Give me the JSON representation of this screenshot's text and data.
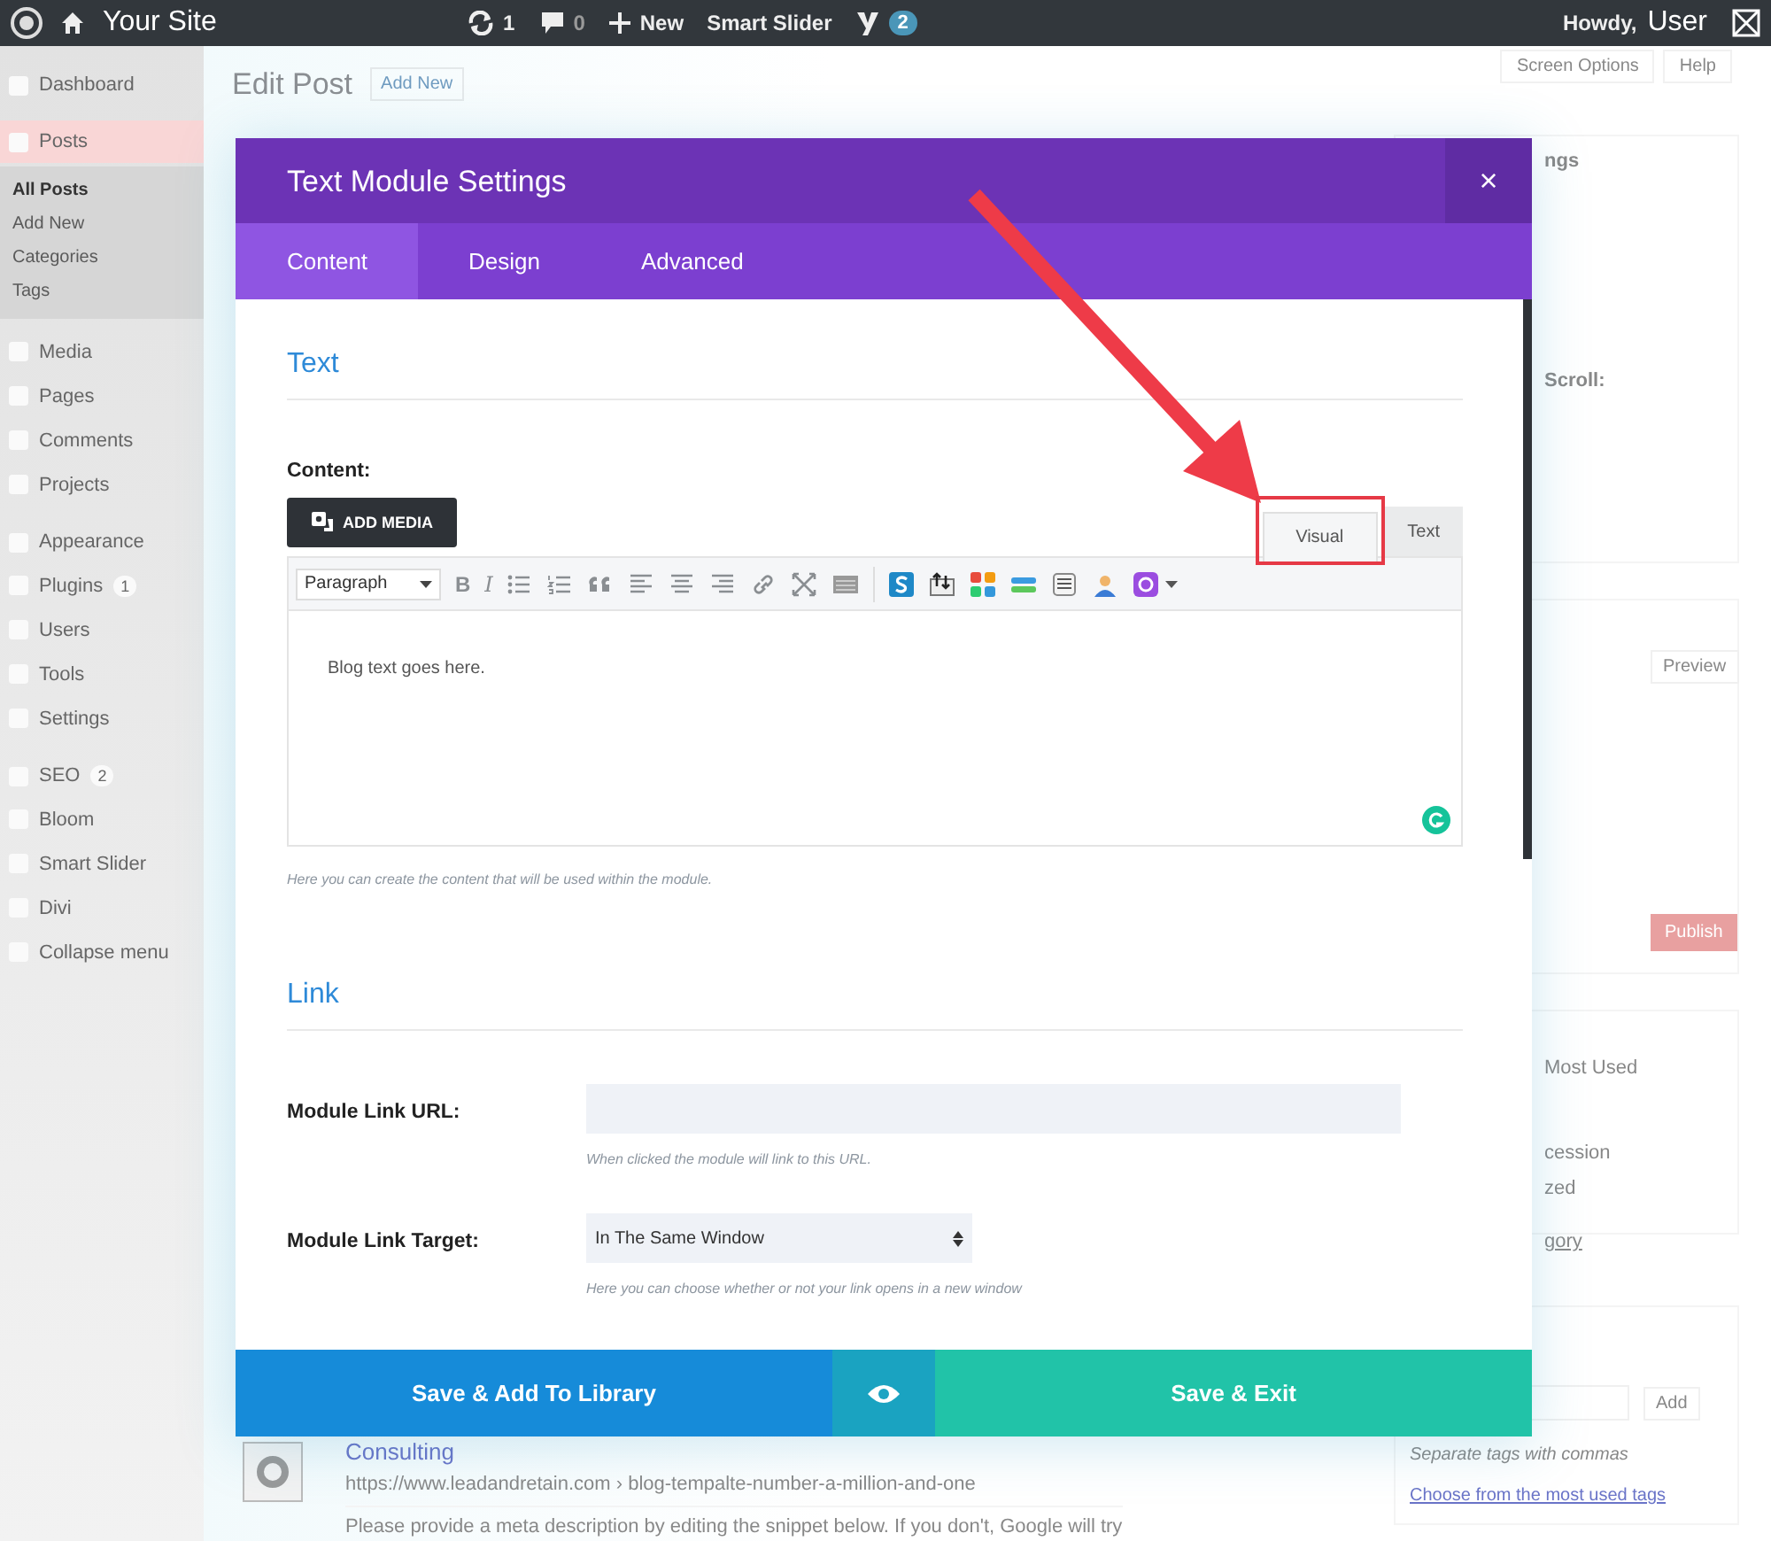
{
  "admin_bar": {
    "site_name": "Your Site",
    "updates": "1",
    "comments": "0",
    "new": "New",
    "smart_slider": "Smart Slider",
    "seo_badge": "2",
    "greeting": "Howdy,",
    "user": "User"
  },
  "sidebar": {
    "groups": [
      [
        {
          "label": "Dashboard",
          "selected": false
        }
      ],
      [
        {
          "label": "Posts",
          "selected": true,
          "children": [
            {
              "label": "All Posts",
              "selected": true
            },
            {
              "label": "Add New",
              "selected": false
            },
            {
              "label": "Categories",
              "selected": false
            },
            {
              "label": "Tags",
              "selected": false
            }
          ]
        },
        {
          "label": "Media",
          "selected": false
        },
        {
          "label": "Pages",
          "selected": false
        },
        {
          "label": "Comments",
          "selected": false
        },
        {
          "label": "Projects",
          "selected": false
        }
      ],
      [
        {
          "label": "Appearance",
          "selected": false
        },
        {
          "label": "Plugins",
          "selected": false,
          "badge": "1"
        },
        {
          "label": "Users",
          "selected": false
        },
        {
          "label": "Tools",
          "selected": false
        },
        {
          "label": "Settings",
          "selected": false
        }
      ],
      [
        {
          "label": "SEO",
          "selected": false,
          "badge": "2"
        },
        {
          "label": "Bloom",
          "selected": false
        },
        {
          "label": "Smart Slider",
          "selected": false
        },
        {
          "label": "Divi",
          "selected": false
        },
        {
          "label": "Collapse menu",
          "selected": false
        }
      ]
    ]
  },
  "page": {
    "title": "Edit Post",
    "add_new": "Add New",
    "screen_options": "Screen Options",
    "help": "Help"
  },
  "right_panel": {
    "settings_header": "ngs",
    "scroll_label": "Scroll:",
    "preview": "Preview",
    "publish": "Publish",
    "most_used": "Most Used",
    "category_items": [
      "cession",
      "zed"
    ],
    "category_link": "gory",
    "tag_add": "Add",
    "tag_hint": "Separate tags with commas",
    "tag_link": "Choose from the most used tags"
  },
  "seo_preview": {
    "title": "Consulting",
    "url": "https://www.leadandretain.com › blog-tempalte-number-a-million-and-one",
    "description": "Please provide a meta description by editing the snippet below. If you don't, Google will try"
  },
  "modal": {
    "title": "Text Module Settings",
    "close": "×",
    "tabs": [
      {
        "label": "Content",
        "selected": true
      },
      {
        "label": "Design",
        "selected": false
      },
      {
        "label": "Advanced",
        "selected": false
      }
    ],
    "text_section": {
      "heading": "Text",
      "field_label": "Content:",
      "add_media": "ADD MEDIA",
      "editor_tabs": [
        {
          "label": "Visual",
          "selected": true,
          "highlighted": true
        },
        {
          "label": "Text",
          "selected": false,
          "highlighted": false
        }
      ],
      "format": "Paragraph",
      "bold_glyph": "B",
      "italic_glyph": "I",
      "content": "Blog text goes here.",
      "help": "Here you can create the content that will be used within the module."
    },
    "link_section": {
      "heading": "Link",
      "fields": [
        {
          "kind": "text",
          "label": "Module Link URL:",
          "help": "When clicked the module will link to this URL."
        },
        {
          "kind": "select",
          "label": "Module Link Target:",
          "value": "In The Same Window",
          "help": "Here you can choose whether or not your link opens in a new window"
        }
      ]
    },
    "footer": {
      "save_library": "Save & Add To Library",
      "save_exit": "Save & Exit"
    }
  }
}
